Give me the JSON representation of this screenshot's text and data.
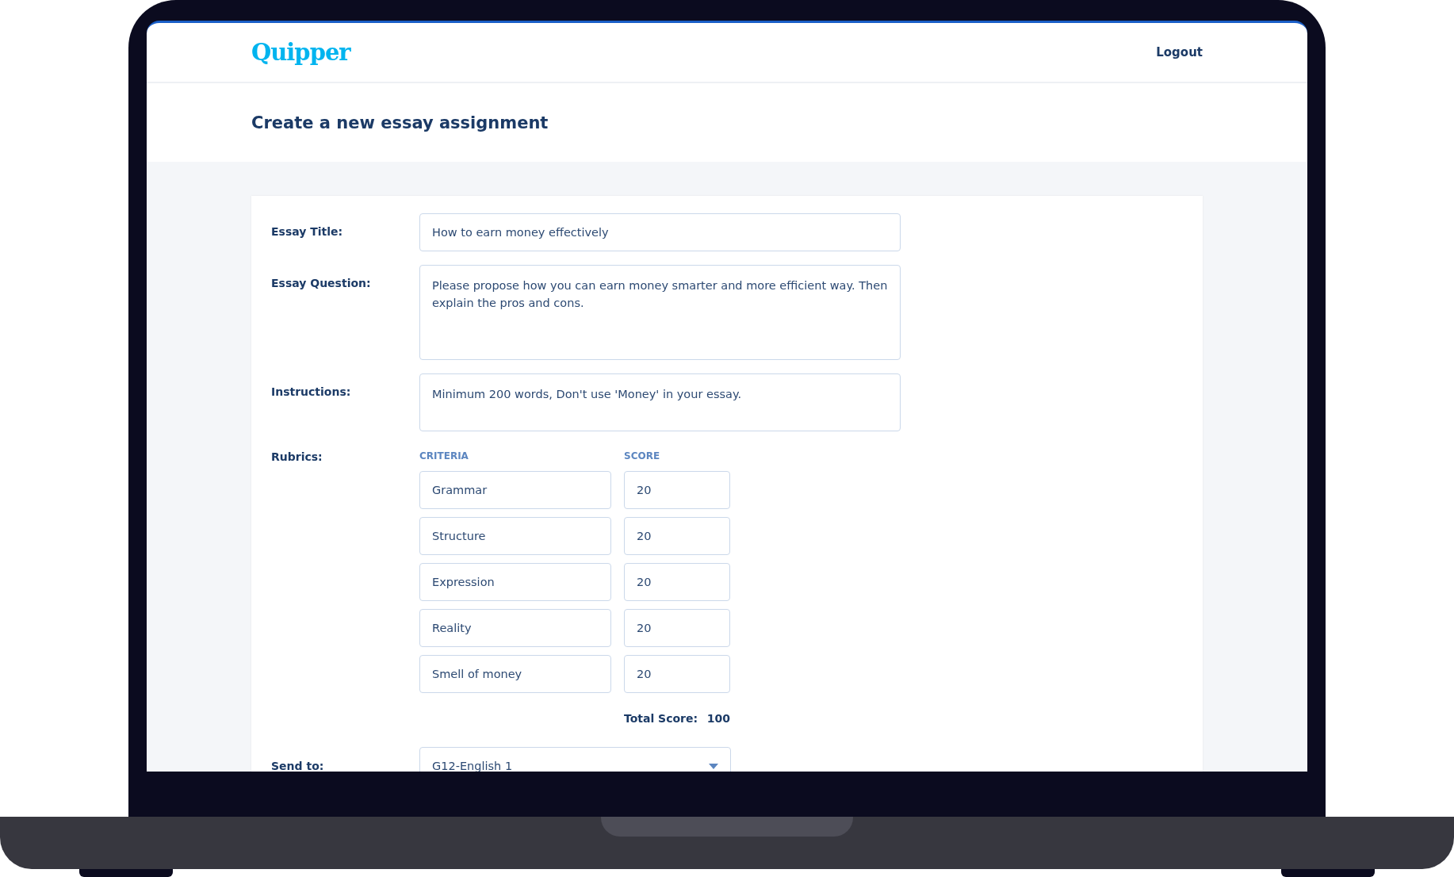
{
  "header": {
    "logo": "Quipper",
    "logout": "Logout"
  },
  "page_title": "Create a new essay assignment",
  "fields": [
    {
      "kind": "text",
      "label": "Essay Title:",
      "value": "How to earn money effectively"
    },
    {
      "kind": "textarea",
      "label": "Essay Question:",
      "value": "Please propose how you can earn money smarter and more efficient way. Then explain the pros and cons."
    },
    {
      "kind": "textarea_short",
      "label": "Instructions:",
      "value": "Minimum 200 words, Don't use 'Money' in your essay."
    }
  ],
  "rubrics": {
    "label": "Rubrics:",
    "criteria_heading": "CRITERIA",
    "score_heading": "SCORE",
    "rows": [
      {
        "criteria": "Grammar",
        "score": "20"
      },
      {
        "criteria": "Structure",
        "score": "20"
      },
      {
        "criteria": "Expression",
        "score": "20"
      },
      {
        "criteria": "Reality",
        "score": "20"
      },
      {
        "criteria": "Smell of money",
        "score": "20"
      }
    ],
    "total_label": "Total Score:",
    "total_value": "100"
  },
  "send_to": {
    "label": "Send to:",
    "value": "G12-English 1"
  }
}
